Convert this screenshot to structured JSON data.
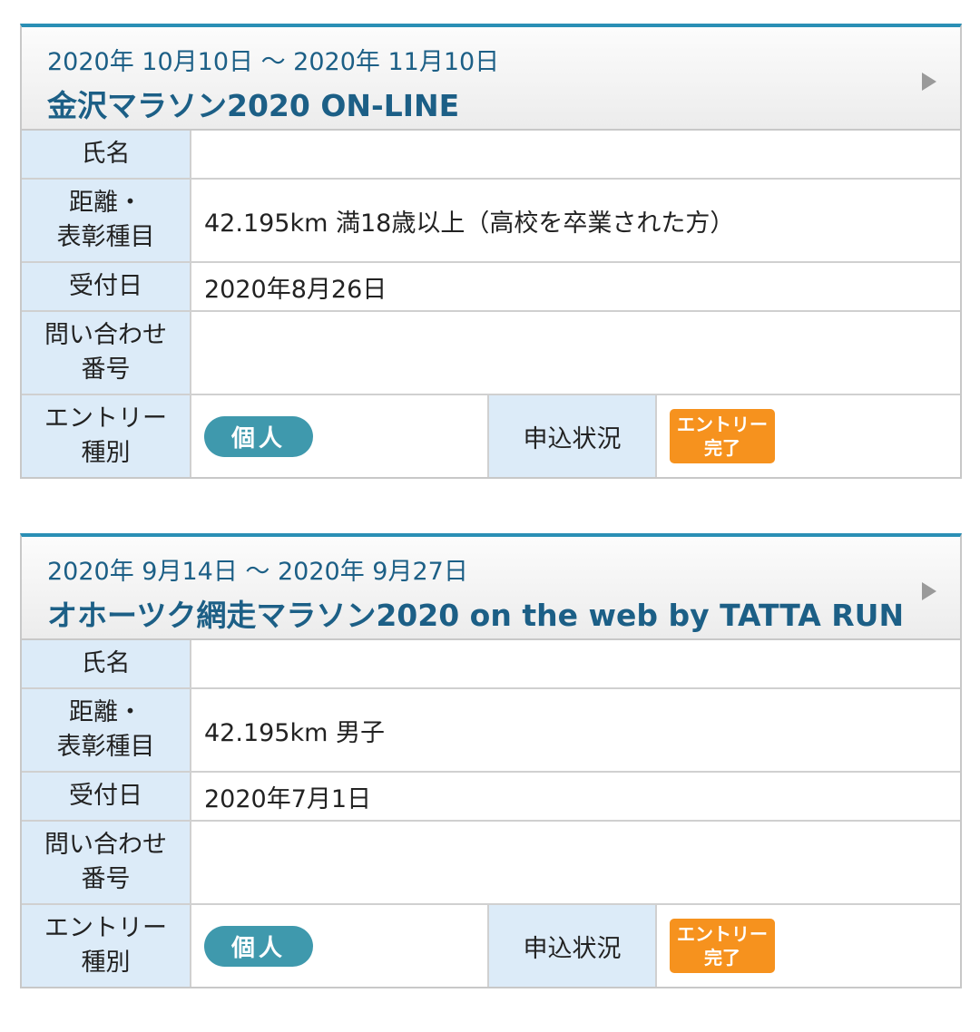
{
  "labels": {
    "name_1": "氏名",
    "dist_1": "距離・",
    "dist_2": "表彰種目",
    "date_1": "受付日",
    "inq_1": "問い合わせ",
    "inq_2": "番号",
    "type_1": "エントリー",
    "type_2": "種別",
    "status": "申込状況"
  },
  "badges": {
    "kojin": "個人",
    "entry_1": "エントリー",
    "entry_2": "完了"
  },
  "colors": {
    "accent": "#2a8fb5",
    "title": "#1c5f86",
    "label_bg": "#dcebf8",
    "badge_kojin": "#3f99ad",
    "badge_entry": "#f6921e"
  },
  "icons": {
    "header_arrow": "triangle-right-icon"
  },
  "entries": [
    {
      "dates": "2020年 10月10日 ～ 2020年 11月10日",
      "title": "金沢マラソン2020 ON-LINE",
      "name": "",
      "distance": "42.195km 満18歳以上（高校を卒業された方）",
      "received": "2020年8月26日",
      "inquiry": ""
    },
    {
      "dates": "2020年 9月14日 ～ 2020年 9月27日",
      "title": "オホーツク網走マラソン2020 on the web by TATTA RUN",
      "name": "",
      "distance": "42.195km 男子",
      "received": "2020年7月1日",
      "inquiry": ""
    }
  ]
}
